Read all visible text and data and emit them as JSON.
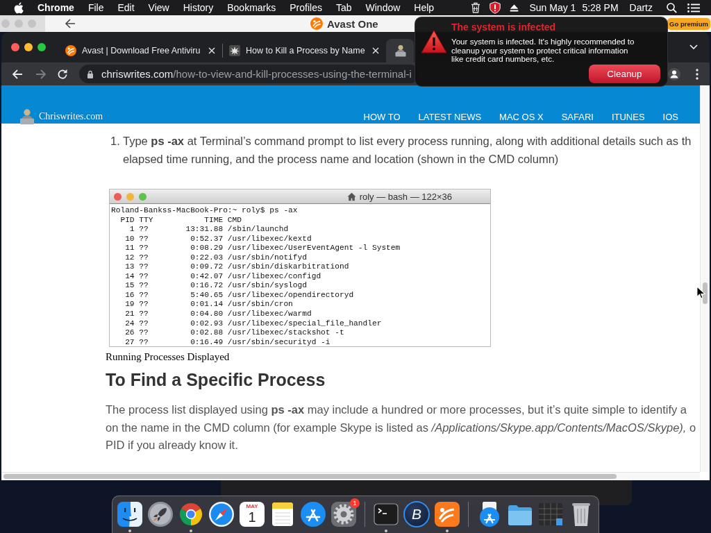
{
  "menu_bar": {
    "app": "Chrome",
    "menus": [
      "File",
      "Edit",
      "View",
      "History",
      "Bookmarks",
      "Profiles",
      "Tab",
      "Window",
      "Help"
    ],
    "date": "Sun May 1",
    "time": "5:28 PM",
    "user": "Dartz"
  },
  "background_window": {
    "brand": "Avast One",
    "button": "Go premium"
  },
  "browser": {
    "tabs": [
      {
        "title": "Avast | Download Free Antiviru",
        "kind": "avast",
        "selected": false
      },
      {
        "title": "How to Kill a Process by Name",
        "kind": "burst",
        "selected": false
      },
      {
        "kind": "site",
        "selected": true
      }
    ],
    "forward": {
      "disabled": true
    },
    "address": {
      "domain": "chriswrites.com",
      "path": "/how-to-view-and-kill-processes-using-the-terminal-i"
    }
  },
  "site_header": {
    "logo": "Chriswrites.com",
    "nav": [
      "HOW TO",
      "LATEST NEWS",
      "MAC OS X",
      "SAFARI",
      "ITUNES",
      "IOS"
    ]
  },
  "article": {
    "step": {
      "number": "1.",
      "lines": [
        "Type **ps -ax** at Terminal’s command prompt to list every process running, along with additional details such as th",
        "elapsed time running, and the process name and location (shown in the CMD column)"
      ]
    },
    "terminal": {
      "title": "roly — bash — 122×36",
      "lines": [
        "Roland-Bankss-MacBook-Pro:~ roly$ ps -ax",
        "  PID TTY           TIME CMD",
        "    1 ??        13:31.88 /sbin/launchd",
        "   10 ??         0:52.37 /usr/libexec/kextd",
        "   11 ??         0:08.29 /usr/libexec/UserEventAgent -l System",
        "   12 ??         0:22.03 /usr/sbin/notifyd",
        "   13 ??         0:09.72 /usr/sbin/diskarbitrationd",
        "   14 ??         0:42.07 /usr/libexec/configd",
        "   15 ??         0:16.72 /usr/sbin/syslogd",
        "   16 ??         5:40.65 /usr/libexec/opendirectoryd",
        "   19 ??         0:01.14 /usr/sbin/cron",
        "   21 ??         0:04.80 /usr/libexec/warmd",
        "   24 ??         0:02.93 /usr/libexec/special_file_handler",
        "   26 ??         0:02.88 /usr/libexec/stackshot -t",
        "   27 ??         0:16.49 /usr/sbin/securityd -i"
      ]
    },
    "caption": "Running Processes Displayed",
    "heading": "To Find a Specific Process",
    "paragraph": [
      "The process list displayed using **ps -ax** may include a hundred or more processes, but it’s quite simple to identify a",
      "on the name in the CMD column (for example Skype is listed as */Applications/Skype.app/Contents/MacOS/Skype),* o",
      "PID if you already know it."
    ]
  },
  "popup": {
    "title": "The system is infected",
    "message": "Your system is infected. It's highly recommended to cleanup your system to protect critical information like credit card numbers, etc.",
    "button": "Cleanup"
  },
  "dock": {
    "items": [
      {
        "kind": "finder",
        "running": true
      },
      {
        "kind": "launchpad",
        "running": false
      },
      {
        "kind": "chrome",
        "running": true
      },
      {
        "kind": "safari",
        "running": false
      },
      {
        "kind": "calendar",
        "month": "MAY",
        "day": "1",
        "running": false
      },
      {
        "kind": "notes",
        "running": false
      },
      {
        "kind": "appstore",
        "running": false
      },
      {
        "kind": "settings",
        "badge": "1",
        "running": false
      },
      {
        "kind": "separator"
      },
      {
        "kind": "terminal",
        "running": true
      },
      {
        "kind": "letter",
        "letter": "B",
        "running": false
      },
      {
        "kind": "avast",
        "running": true
      },
      {
        "kind": "separator"
      },
      {
        "kind": "appstack",
        "running": false
      },
      {
        "kind": "folder",
        "running": false
      },
      {
        "kind": "stack",
        "running": false
      },
      {
        "kind": "trash",
        "running": false
      }
    ]
  }
}
